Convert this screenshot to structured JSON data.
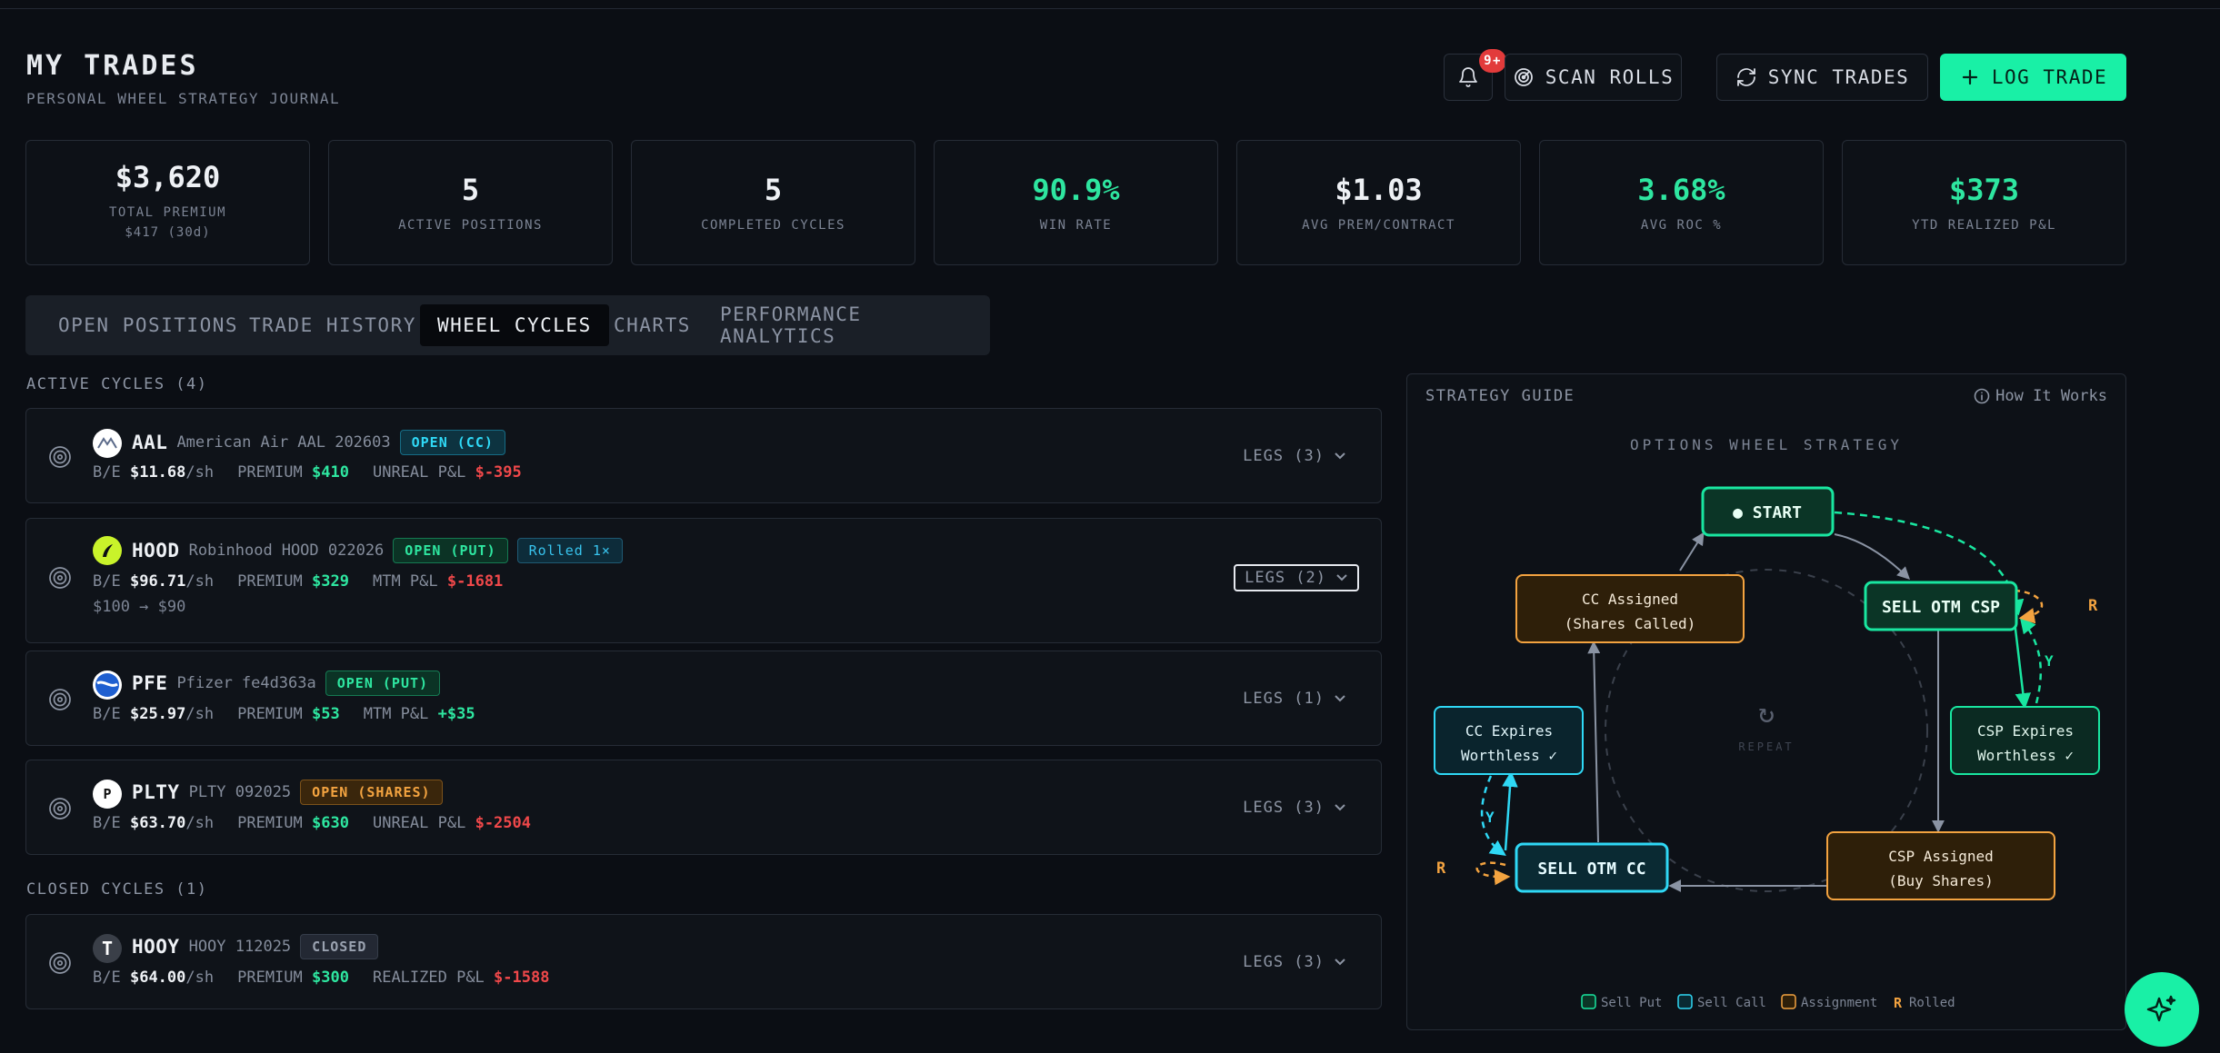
{
  "header": {
    "title": "MY TRADES",
    "subtitle": "PERSONAL WHEEL STRATEGY JOURNAL",
    "notifications_badge": "9+",
    "scan_label": "SCAN ROLLS",
    "sync_label": "SYNC TRADES",
    "log_label": "LOG TRADE"
  },
  "stats": [
    {
      "value": "$3,620",
      "label": "TOTAL PREMIUM",
      "sub": "$417 (30d)",
      "accent": "white"
    },
    {
      "value": "5",
      "label": "ACTIVE POSITIONS",
      "sub": "",
      "accent": "white"
    },
    {
      "value": "5",
      "label": "COMPLETED CYCLES",
      "sub": "",
      "accent": "white"
    },
    {
      "value": "90.9%",
      "label": "WIN RATE",
      "sub": "",
      "accent": "green"
    },
    {
      "value": "$1.03",
      "label": "AVG PREM/CONTRACT",
      "sub": "",
      "accent": "white"
    },
    {
      "value": "3.68%",
      "label": "AVG ROC %",
      "sub": "",
      "accent": "green"
    },
    {
      "value": "$373",
      "label": "YTD REALIZED P&L",
      "sub": "",
      "accent": "green"
    }
  ],
  "tabs": [
    {
      "label": "OPEN POSITIONS",
      "active": false
    },
    {
      "label": "TRADE HISTORY",
      "active": false
    },
    {
      "label": "WHEEL CYCLES",
      "active": true
    },
    {
      "label": "CHARTS",
      "active": false
    },
    {
      "label": "PERFORMANCE ANALYTICS",
      "active": false
    }
  ],
  "active_heading": "ACTIVE CYCLES (4)",
  "closed_heading": "CLOSED CYCLES (1)",
  "active_cycles": [
    {
      "ticker": "AAL",
      "name": "American Air",
      "id": "AAL 202603",
      "status": "OPEN (CC)",
      "be_label": "B/E",
      "be_value": "$11.68",
      "be_unit": "/sh",
      "premium_label": "PREMIUM",
      "premium_value": "$410",
      "pnl_label": "UNREAL P&L",
      "pnl_value": "$-395",
      "legs": "LEGS (3)"
    },
    {
      "ticker": "HOOD",
      "name": "Robinhood",
      "id": "HOOD 022026",
      "status": "OPEN (PUT)",
      "rolled": "Rolled 1×",
      "be_label": "B/E",
      "be_value": "$96.71",
      "be_unit": "/sh",
      "premium_label": "PREMIUM",
      "premium_value": "$329",
      "pnl_label": "MTM P&L",
      "pnl_value": "$-1681",
      "roll_path": "$100 → $90",
      "legs": "LEGS (2)"
    },
    {
      "ticker": "PFE",
      "name": "Pfizer",
      "id": "fe4d363a",
      "status": "OPEN (PUT)",
      "be_label": "B/E",
      "be_value": "$25.97",
      "be_unit": "/sh",
      "premium_label": "PREMIUM",
      "premium_value": "$53",
      "pnl_label": "MTM P&L",
      "pnl_value": "+$35",
      "legs": "LEGS (1)"
    },
    {
      "ticker": "PLTY",
      "name": "",
      "id": "PLTY 092025",
      "logo_letter": "P",
      "status": "OPEN (SHARES)",
      "be_label": "B/E",
      "be_value": "$63.70",
      "be_unit": "/sh",
      "premium_label": "PREMIUM",
      "premium_value": "$630",
      "pnl_label": "UNREAL P&L",
      "pnl_value": "$-2504",
      "legs": "LEGS (3)"
    }
  ],
  "closed_cycles": [
    {
      "ticker": "HOOY",
      "name": "",
      "id": "HOOY 112025",
      "logo_letter": "T",
      "status": "CLOSED",
      "be_label": "B/E",
      "be_value": "$64.00",
      "be_unit": "/sh",
      "premium_label": "PREMIUM",
      "premium_value": "$300",
      "pnl_label": "REALIZED P&L",
      "pnl_value": "$-1588",
      "legs": "LEGS (3)"
    }
  ],
  "guide": {
    "heading": "STRATEGY GUIDE",
    "how": "How It Works",
    "diagram_title": "OPTIONS WHEEL STRATEGY",
    "start": "● START",
    "sell_csp": "SELL OTM CSP",
    "csp_expires_1": "CSP Expires",
    "csp_expires_2": "Worthless ✓",
    "csp_assigned_1": "CSP Assigned",
    "csp_assigned_2": "(Buy Shares)",
    "sell_cc": "SELL OTM CC",
    "cc_expires_1": "CC Expires",
    "cc_expires_2": "Worthless ✓",
    "cc_assigned_1": "CC Assigned",
    "cc_assigned_2": "(Shares Called)",
    "repeat_glyph": "↻",
    "repeat": "REPEAT",
    "r": "R",
    "y": "Y",
    "legend_put": "Sell Put",
    "legend_call": "Sell Call",
    "legend_assign": "Assignment",
    "legend_rolled_key": "R",
    "legend_rolled": "Rolled"
  },
  "colors": {
    "accent_green": "#19f0a6",
    "put_green": "#2ee6a0",
    "call_cyan": "#2fd8f5",
    "assign_orange": "#f3a340",
    "loss_red": "#f0484a"
  }
}
